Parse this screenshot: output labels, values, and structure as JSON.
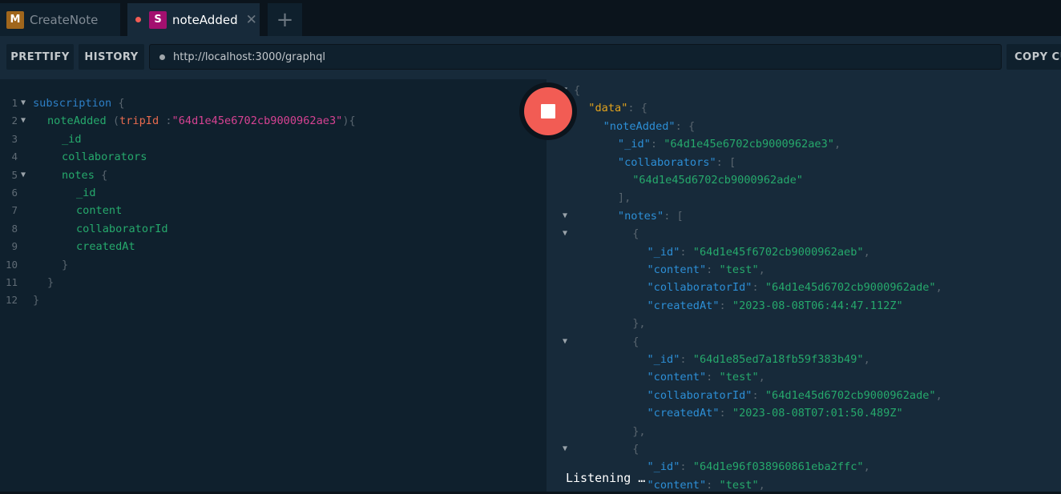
{
  "tabs": [
    {
      "label": "CreateNote",
      "badge": "M",
      "badge_color": "#a0661c",
      "active": false
    },
    {
      "label": "noteAdded",
      "badge": "S",
      "badge_color": "#a3106f",
      "active": true,
      "unsaved_dot": true
    }
  ],
  "new_tab_icon": "plus-icon",
  "toolbar": {
    "prettify": "PRETTIFY",
    "history": "HISTORY",
    "url": "http://localhost:3000/graphql",
    "copy": "COPY CU"
  },
  "query_lines": [
    {
      "n": "1",
      "fold": true,
      "indent": 0,
      "tokens": [
        [
          "kw",
          "subscription"
        ],
        [
          "punc",
          " {"
        ]
      ]
    },
    {
      "n": "2",
      "fold": true,
      "indent": 1,
      "tokens": [
        [
          "field",
          "noteAdded"
        ],
        [
          "punc",
          " ("
        ],
        [
          "arg",
          "tripId"
        ],
        [
          "punc",
          " :"
        ],
        [
          "str",
          "\"64d1e45e6702cb9000962ae3\""
        ],
        [
          "punc",
          "){"
        ]
      ]
    },
    {
      "n": "3",
      "indent": 2,
      "tokens": [
        [
          "field",
          "_id"
        ]
      ]
    },
    {
      "n": "4",
      "indent": 2,
      "tokens": [
        [
          "field",
          "collaborators"
        ]
      ]
    },
    {
      "n": "5",
      "fold": true,
      "indent": 2,
      "tokens": [
        [
          "field",
          "notes"
        ],
        [
          "punc",
          " {"
        ]
      ]
    },
    {
      "n": "6",
      "indent": 3,
      "tokens": [
        [
          "field",
          "_id"
        ]
      ]
    },
    {
      "n": "7",
      "indent": 3,
      "tokens": [
        [
          "field",
          "content"
        ]
      ]
    },
    {
      "n": "8",
      "indent": 3,
      "tokens": [
        [
          "field",
          "collaboratorId"
        ]
      ]
    },
    {
      "n": "9",
      "indent": 3,
      "tokens": [
        [
          "field",
          "createdAt"
        ]
      ]
    },
    {
      "n": "10",
      "indent": 2,
      "tokens": [
        [
          "punc",
          "}"
        ]
      ]
    },
    {
      "n": "11",
      "indent": 1,
      "tokens": [
        [
          "punc",
          "}"
        ]
      ]
    },
    {
      "n": "12",
      "indent": 0,
      "tokens": [
        [
          "punc",
          "}"
        ]
      ]
    }
  ],
  "result_lines": [
    {
      "fold": true,
      "indent": 0,
      "tokens": [
        [
          "punc",
          "{"
        ]
      ]
    },
    {
      "indent": 1,
      "tokens": [
        [
          "data",
          "\"data\""
        ],
        [
          "punc",
          ": {"
        ]
      ]
    },
    {
      "indent": 2,
      "tokens": [
        [
          "key",
          "\"noteAdded\""
        ],
        [
          "punc",
          ": {"
        ]
      ]
    },
    {
      "indent": 3,
      "tokens": [
        [
          "key",
          "\"_id\""
        ],
        [
          "punc",
          ": "
        ],
        [
          "val",
          "\"64d1e45e6702cb9000962ae3\""
        ],
        [
          "punc",
          ","
        ]
      ]
    },
    {
      "indent": 3,
      "tokens": [
        [
          "key",
          "\"collaborators\""
        ],
        [
          "punc",
          ": ["
        ]
      ]
    },
    {
      "indent": 4,
      "tokens": [
        [
          "val",
          "\"64d1e45d6702cb9000962ade\""
        ]
      ]
    },
    {
      "indent": 3,
      "tokens": [
        [
          "punc",
          "],"
        ]
      ]
    },
    {
      "fold": true,
      "indent": 3,
      "tokens": [
        [
          "key",
          "\"notes\""
        ],
        [
          "punc",
          ": ["
        ]
      ]
    },
    {
      "fold": true,
      "indent": 4,
      "tokens": [
        [
          "punc",
          "{"
        ]
      ]
    },
    {
      "indent": 5,
      "tokens": [
        [
          "key",
          "\"_id\""
        ],
        [
          "punc",
          ": "
        ],
        [
          "val",
          "\"64d1e45f6702cb9000962aeb\""
        ],
        [
          "punc",
          ","
        ]
      ]
    },
    {
      "indent": 5,
      "tokens": [
        [
          "key",
          "\"content\""
        ],
        [
          "punc",
          ": "
        ],
        [
          "val",
          "\"test\""
        ],
        [
          "punc",
          ","
        ]
      ]
    },
    {
      "indent": 5,
      "tokens": [
        [
          "key",
          "\"collaboratorId\""
        ],
        [
          "punc",
          ": "
        ],
        [
          "val",
          "\"64d1e45d6702cb9000962ade\""
        ],
        [
          "punc",
          ","
        ]
      ]
    },
    {
      "indent": 5,
      "tokens": [
        [
          "key",
          "\"createdAt\""
        ],
        [
          "punc",
          ": "
        ],
        [
          "val",
          "\"2023-08-08T06:44:47.112Z\""
        ]
      ]
    },
    {
      "indent": 4,
      "tokens": [
        [
          "punc",
          "},"
        ]
      ]
    },
    {
      "fold": true,
      "indent": 4,
      "tokens": [
        [
          "punc",
          "{"
        ]
      ]
    },
    {
      "indent": 5,
      "tokens": [
        [
          "key",
          "\"_id\""
        ],
        [
          "punc",
          ": "
        ],
        [
          "val",
          "\"64d1e85ed7a18fb59f383b49\""
        ],
        [
          "punc",
          ","
        ]
      ]
    },
    {
      "indent": 5,
      "tokens": [
        [
          "key",
          "\"content\""
        ],
        [
          "punc",
          ": "
        ],
        [
          "val",
          "\"test\""
        ],
        [
          "punc",
          ","
        ]
      ]
    },
    {
      "indent": 5,
      "tokens": [
        [
          "key",
          "\"collaboratorId\""
        ],
        [
          "punc",
          ": "
        ],
        [
          "val",
          "\"64d1e45d6702cb9000962ade\""
        ],
        [
          "punc",
          ","
        ]
      ]
    },
    {
      "indent": 5,
      "tokens": [
        [
          "key",
          "\"createdAt\""
        ],
        [
          "punc",
          ": "
        ],
        [
          "val",
          "\"2023-08-08T07:01:50.489Z\""
        ]
      ]
    },
    {
      "indent": 4,
      "tokens": [
        [
          "punc",
          "},"
        ]
      ]
    },
    {
      "fold": true,
      "indent": 4,
      "tokens": [
        [
          "punc",
          "{"
        ]
      ]
    },
    {
      "indent": 5,
      "tokens": [
        [
          "key",
          "\"_id\""
        ],
        [
          "punc",
          ": "
        ],
        [
          "val",
          "\"64d1e96f038960861eba2ffc\""
        ],
        [
          "punc",
          ","
        ]
      ]
    },
    {
      "indent": 5,
      "tokens": [
        [
          "key",
          "\"content\""
        ],
        [
          "punc",
          ": "
        ],
        [
          "val",
          "\"test\""
        ],
        [
          "punc",
          ","
        ]
      ]
    }
  ],
  "status": "Listening …",
  "stop_button_icon": "stop-icon",
  "colors": {
    "accent_red": "#f25c54",
    "editor_bg": "#0f202d",
    "result_bg": "#172a3a"
  }
}
